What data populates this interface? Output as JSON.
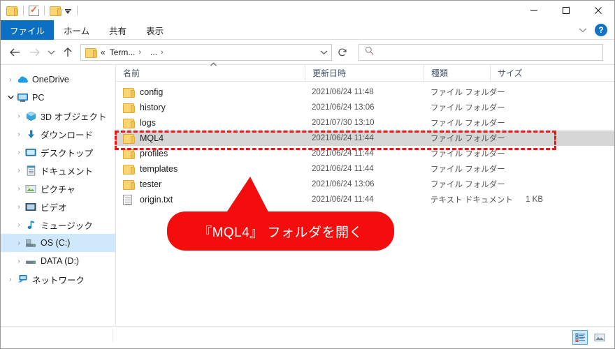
{
  "window": {
    "controls": {
      "minimize": "minimize-icon",
      "maximize": "maximize-icon",
      "close": "close-icon"
    }
  },
  "quick_access": {
    "items": [
      {
        "name": "folder-icon",
        "label": ""
      },
      {
        "name": "properties-icon",
        "label": ""
      },
      {
        "name": "new-folder-icon",
        "label": ""
      },
      {
        "name": "customize-dropdown-icon",
        "label": ""
      }
    ]
  },
  "ribbon": {
    "tabs": [
      {
        "label": "ファイル",
        "active": true
      },
      {
        "label": "ホーム",
        "active": false
      },
      {
        "label": "共有",
        "active": false
      },
      {
        "label": "表示",
        "active": false
      }
    ],
    "collapse_icon": "chevron-down-icon",
    "help_label": "?"
  },
  "address_bar": {
    "back_icon": "arrow-left-icon",
    "forward_icon": "arrow-right-icon",
    "recent_icon": "chevron-down-icon",
    "up_icon": "arrow-up-icon",
    "breadcrumb": {
      "overflow": "«",
      "segments": [
        "Term...",
        "..."
      ],
      "separator": "›"
    },
    "dropdown_icon": "chevron-down-icon",
    "refresh_icon": "refresh-icon"
  },
  "search": {
    "icon": "search-icon",
    "value": "",
    "placeholder": ""
  },
  "sidebar": {
    "items": [
      {
        "label": "OneDrive",
        "icon": "onedrive-cloud-icon",
        "level": 1,
        "expanded": false,
        "selected": false
      },
      {
        "label": "PC",
        "icon": "this-pc-icon",
        "level": 1,
        "expanded": true,
        "selected": false
      },
      {
        "label": "3D オブジェクト",
        "icon": "3d-objects-icon",
        "level": 2,
        "expanded": false,
        "selected": false
      },
      {
        "label": "ダウンロード",
        "icon": "downloads-icon",
        "level": 2,
        "expanded": false,
        "selected": false
      },
      {
        "label": "デスクトップ",
        "icon": "desktop-icon",
        "level": 2,
        "expanded": false,
        "selected": false
      },
      {
        "label": "ドキュメント",
        "icon": "documents-icon",
        "level": 2,
        "expanded": false,
        "selected": false
      },
      {
        "label": "ピクチャ",
        "icon": "pictures-icon",
        "level": 2,
        "expanded": false,
        "selected": false
      },
      {
        "label": "ビデオ",
        "icon": "videos-icon",
        "level": 2,
        "expanded": false,
        "selected": false
      },
      {
        "label": "ミュージック",
        "icon": "music-icon",
        "level": 2,
        "expanded": false,
        "selected": false
      },
      {
        "label": "OS (C:)",
        "icon": "hard-drive-icon",
        "level": 2,
        "expanded": false,
        "selected": true
      },
      {
        "label": "DATA (D:)",
        "icon": "hard-drive-icon",
        "level": 2,
        "expanded": false,
        "selected": false
      },
      {
        "label": "ネットワーク",
        "icon": "network-icon",
        "level": 1,
        "expanded": false,
        "selected": false
      }
    ]
  },
  "file_list": {
    "columns": [
      {
        "label": "名前",
        "key": "name"
      },
      {
        "label": "更新日時",
        "key": "date"
      },
      {
        "label": "種類",
        "key": "type"
      },
      {
        "label": "サイズ",
        "key": "size"
      }
    ],
    "sort": {
      "column": "名前",
      "direction": "ascending",
      "icon": "caret-up-icon"
    },
    "rows": [
      {
        "name": "config",
        "date": "2021/06/24 11:48",
        "type": "ファイル フォルダー",
        "size": "",
        "icon": "folder-icon",
        "selected": false
      },
      {
        "name": "history",
        "date": "2021/06/24 13:06",
        "type": "ファイル フォルダー",
        "size": "",
        "icon": "folder-icon",
        "selected": false
      },
      {
        "name": "logs",
        "date": "2021/07/30 13:10",
        "type": "ファイル フォルダー",
        "size": "",
        "icon": "folder-icon",
        "selected": false
      },
      {
        "name": "MQL4",
        "date": "2021/06/24 11:44",
        "type": "ファイル フォルダー",
        "size": "",
        "icon": "folder-icon",
        "selected": true
      },
      {
        "name": "profiles",
        "date": "2021/06/24 11:44",
        "type": "ファイル フォルダー",
        "size": "",
        "icon": "folder-icon",
        "selected": false
      },
      {
        "name": "templates",
        "date": "2021/06/24 11:44",
        "type": "ファイル フォルダー",
        "size": "",
        "icon": "folder-icon",
        "selected": false
      },
      {
        "name": "tester",
        "date": "2021/06/24 13:06",
        "type": "ファイル フォルダー",
        "size": "",
        "icon": "folder-icon",
        "selected": false
      },
      {
        "name": "origin.txt",
        "date": "2021/06/24 11:44",
        "type": "テキスト ドキュメント",
        "size": "1 KB",
        "icon": "text-document-icon",
        "selected": false
      }
    ]
  },
  "status_bar": {
    "text": "",
    "view_buttons": [
      {
        "name": "details-view-button",
        "active": true
      },
      {
        "name": "large-icons-view-button",
        "active": false
      }
    ]
  },
  "annotations": {
    "highlight_color": "#f31414",
    "callout": {
      "text": "『MQL4』 フォルダを開く",
      "background": "#f40d0d",
      "text_color": "#ffffff"
    }
  }
}
